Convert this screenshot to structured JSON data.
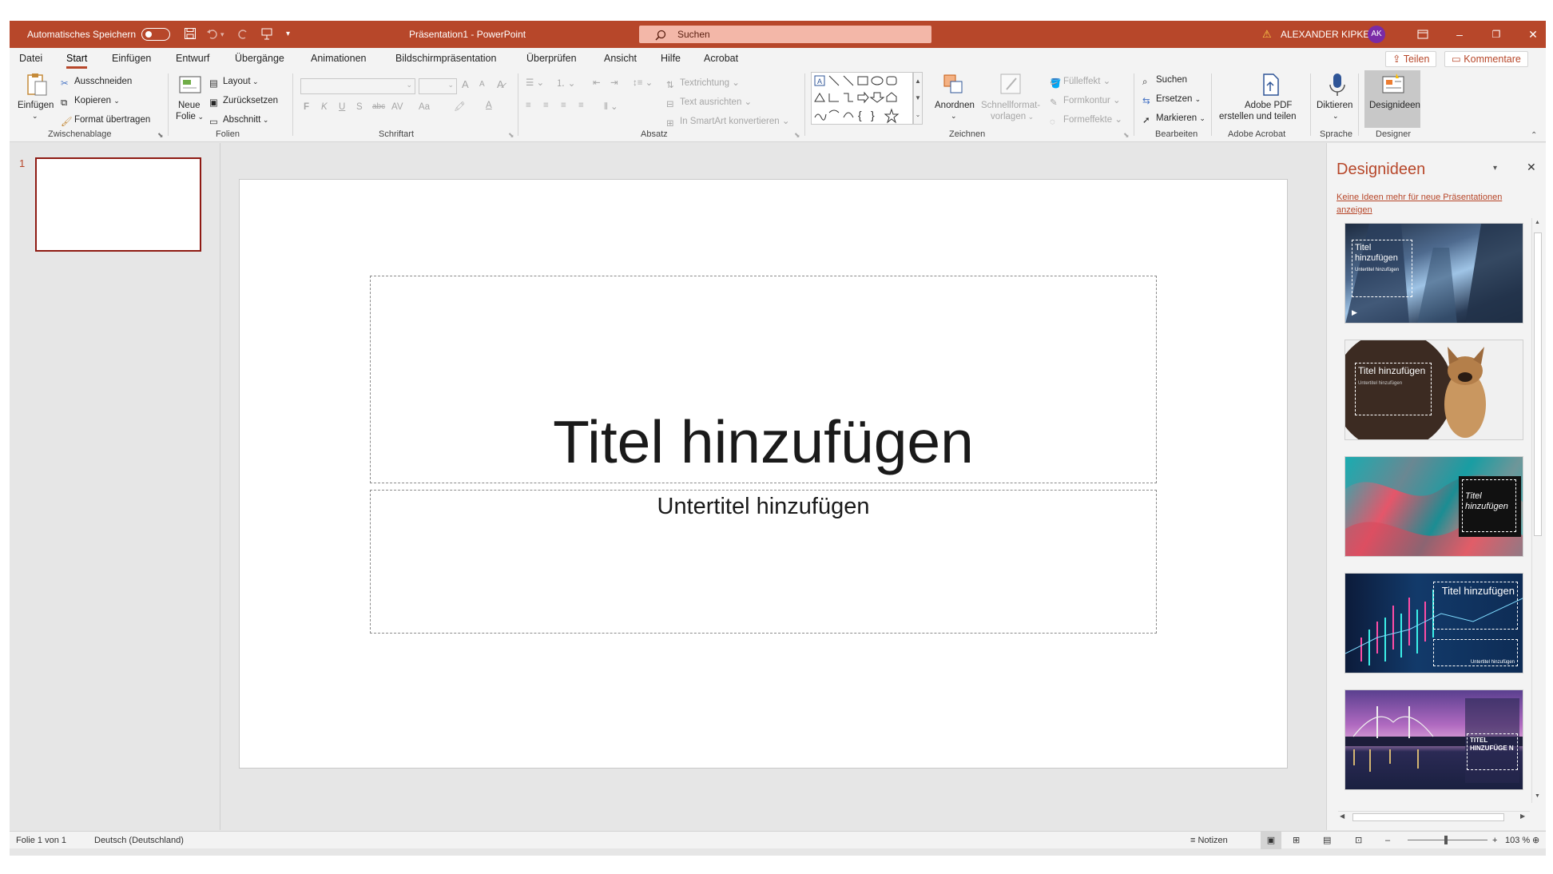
{
  "colors": {
    "accent": "#b7472a",
    "titlebar": "#b7472a",
    "thumb_border": "#8e1a13"
  },
  "titlebar": {
    "autosave_label": "Automatisches Speichern",
    "document_title": "Präsentation1  -  PowerPoint",
    "search_placeholder": "Suchen",
    "user_name": "ALEXANDER KIPKE",
    "user_initials": "AK"
  },
  "tabs": [
    "Datei",
    "Start",
    "Einfügen",
    "Entwurf",
    "Übergänge",
    "Animationen",
    "Bildschirmpräsentation",
    "Überprüfen",
    "Ansicht",
    "Hilfe",
    "Acrobat"
  ],
  "active_tab": "Start",
  "share": {
    "teilen": "Teilen",
    "kommentare": "Kommentare"
  },
  "ribbon": {
    "clipboard": {
      "paste": "Einfügen",
      "cut": "Ausschneiden",
      "copy": "Kopieren",
      "format_painter": "Format übertragen",
      "group": "Zwischenablage"
    },
    "slides": {
      "new_slide_1": "Neue",
      "new_slide_2": "Folie",
      "layout": "Layout",
      "reset": "Zurücksetzen",
      "section": "Abschnitt",
      "group": "Folien"
    },
    "font": {
      "bold": "F",
      "italic": "K",
      "underline": "U",
      "shadow": "S",
      "strike": "abc",
      "spacing": "AV",
      "case": "Aa",
      "grow": "A",
      "shrink": "A",
      "group": "Schriftart"
    },
    "paragraph": {
      "text_direction": "Textrichtung",
      "align_text": "Text ausrichten",
      "smartart": "In SmartArt konvertieren",
      "group": "Absatz"
    },
    "drawing": {
      "arrange": "Anordnen",
      "quick_styles_1": "Schnellformat-",
      "quick_styles_2": "vorlagen",
      "fill": "Fülleffekt",
      "outline": "Formkontur",
      "effects": "Formeffekte",
      "group": "Zeichnen"
    },
    "editing": {
      "find": "Suchen",
      "replace": "Ersetzen",
      "select": "Markieren",
      "group": "Bearbeiten"
    },
    "acrobat": {
      "line1": "Adobe PDF",
      "line2": "erstellen und teilen",
      "group": "Adobe Acrobat"
    },
    "voice": {
      "dictate": "Diktieren",
      "group": "Sprache"
    },
    "designer": {
      "ideas": "Designideen",
      "group": "Designer"
    }
  },
  "thumbnails": {
    "slide_number": "1"
  },
  "slide": {
    "title": "Titel hinzufügen",
    "subtitle": "Untertitel hinzufügen"
  },
  "design_pane": {
    "title": "Designideen",
    "link": "Keine Ideen mehr für neue Präsentationen anzeigen",
    "ideas": [
      {
        "title": "Titel hinzufügen",
        "subtitle": "Untertitel hinzufügen"
      },
      {
        "title": "Titel hinzufügen",
        "subtitle": "Untertitel hinzufügen"
      },
      {
        "title": "Titel hinzufügen",
        "subtitle": ""
      },
      {
        "title": "Titel hinzufügen",
        "subtitle": "Untertitel hinzufügen"
      },
      {
        "title": "TITEL HINZUFÜGE N",
        "subtitle": ""
      }
    ]
  },
  "statusbar": {
    "slide_info": "Folie 1 von 1",
    "language": "Deutsch (Deutschland)",
    "notes": "Notizen",
    "zoom": "103 %"
  }
}
